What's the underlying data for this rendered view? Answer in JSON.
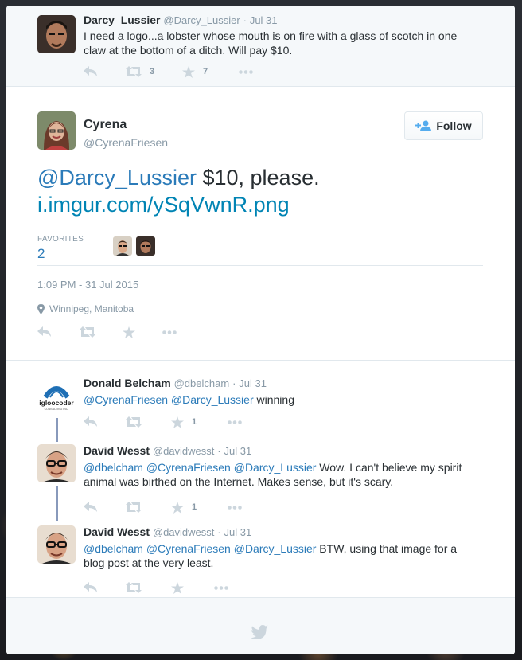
{
  "ancestor": {
    "name": "Darcy_Lussier",
    "handle": "@Darcy_Lussier",
    "sep": "·",
    "date": "Jul 31",
    "text_line1": "I need a logo...a lobster whose mouth is on fire with a glass of scotch in one",
    "text_line2": "claw at the bottom of a ditch. Will pay $10.",
    "retweets": "3",
    "favorites": "7"
  },
  "focus": {
    "name": "Cyrena",
    "handle": "@CyrenaFriesen",
    "follow_label": "Follow",
    "mention": "@Darcy_Lussier",
    "text_rest": " $10, please.",
    "link": "i.imgur.com/ySqVwnR.png",
    "favorites_label": "FAVORITES",
    "favorites_count": "2",
    "timestamp": "1:09 PM - 31 Jul 2015",
    "location": "Winnipeg, Manitoba"
  },
  "replies": [
    {
      "name": "Donald Belcham",
      "handle": "@dbelcham",
      "sep": "·",
      "date": "Jul 31",
      "mention1": "@CyrenaFriesen",
      "mention2": "@Darcy_Lussier",
      "mention3": "",
      "text_line1": " winning",
      "text_line2": "",
      "favorites": "1",
      "logo_text": "igloocoder",
      "logo_sub": "CONSULTING INC."
    },
    {
      "name": "David Wesst",
      "handle": "@davidwesst",
      "sep": "·",
      "date": "Jul 31",
      "mention1": "@dbelcham",
      "mention2": "@CyrenaFriesen",
      "mention3": "@Darcy_Lussier",
      "text_line1": " Wow. I can't believe my spirit",
      "text_line2": "animal was birthed on the Internet. Makes sense, but it's scary.",
      "favorites": "1"
    },
    {
      "name": "David Wesst",
      "handle": "@davidwesst",
      "sep": "·",
      "date": "Jul 31",
      "mention1": "@dbelcham",
      "mention2": "@CyrenaFriesen",
      "mention3": "@Darcy_Lussier",
      "text_line1": " BTW, using that image for a",
      "text_line2": "blog post at the very least.",
      "favorites": ""
    }
  ],
  "icons": {
    "reply": "reply-icon",
    "retweet": "retweet-icon",
    "favorite": "star-icon",
    "more": "more-icon",
    "follow": "add-person-icon",
    "location": "map-pin-icon",
    "footer": "twitter-bird-icon"
  },
  "colors": {
    "link": "#2b7bb9",
    "muted": "#8899a6",
    "icon": "#ccd6dd",
    "thread": "#8899bb"
  }
}
